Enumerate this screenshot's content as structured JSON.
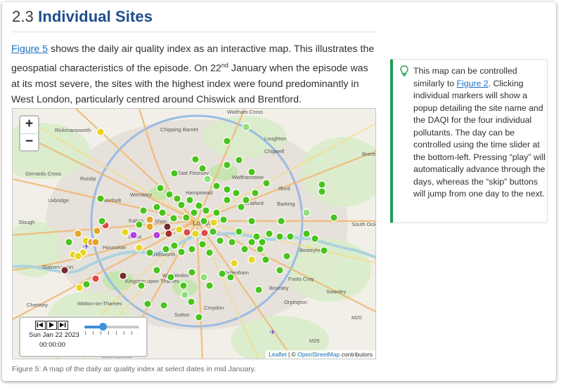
{
  "section": {
    "number": "2.3",
    "title": "Individual Sites"
  },
  "intro": {
    "figure_link": "Figure 5",
    "text_1": " shows the daily air quality index as an interactive map. This illustrates the geospatial characteristics of the episode. On 22",
    "sup": "nd",
    "text_2": " January when the episode was at its most severe, the sites with the highest index were found predominantly in West London, particularly centred around Chiswick and Brentford."
  },
  "map": {
    "zoom_in": "+",
    "zoom_out": "−",
    "place_labels": [
      "Waltham Cross",
      "Chipping Barnet",
      "Loughton",
      "Rickmansworth",
      "Chigwell",
      "Brentwo",
      "Gerrards Cross",
      "Ruislip",
      "East Finchley",
      "Walthamstow",
      "Hampstead",
      "Wembley",
      "Ilford",
      "Uxbridge",
      "Northolt",
      "Stratford",
      "Barking",
      "Slough",
      "Ealing",
      "Shep",
      "London",
      "South Ockend",
      "Brent",
      "Hounslow",
      "Bexleyheath",
      "Staines-upon",
      "Wandsworth",
      "Sydenham",
      "Kingston upon Thames",
      "Wimbledon",
      "Foots Cray",
      "Bromley",
      "Chertsey",
      "Walton-on-Thames",
      "Swanley",
      "Orpington",
      "Croydon",
      "Sutton",
      "Leatherhead",
      "M20",
      "M25"
    ],
    "time_control": {
      "back_icon": "skip-back-icon",
      "play_icon": "play-icon",
      "forward_icon": "skip-forward-icon",
      "date": "Sun Jan 22 2023",
      "time": "00:00:00",
      "slider_position": 0.33
    },
    "attribution": {
      "leaflet": "Leaflet",
      "separator": " | © ",
      "osm": "OpenStreetMap",
      "suffix": " contributors"
    },
    "aqi_colors": {
      "low": "#49c41c",
      "low_light": "#8fe07a",
      "moderate_yellow": "#e8d51e",
      "moderate_orange": "#e5a427",
      "high_red": "#e04747",
      "high_darkred": "#a52a2a",
      "very_high_maroon": "#7a2a2a",
      "very_high_purple": "#b43fe0"
    }
  },
  "caption": "Figure 5: A map of the daily air quality index at select dates in mid January.",
  "callout": {
    "icon": "lightbulb-icon",
    "text_1": "This map can be controlled similarly to ",
    "link": "Figure 2",
    "text_2": ". Clicking individual markers will show a popup detailing the site name and the DAQI for the four individual pollutants. The day can be controlled using the time slider at the bottom-left. Pressing “play” will automatically advance through the days, whereas the “skip” buttons will jump from one day to the next."
  },
  "colors": {
    "heading": "#1f4e8c",
    "link": "#1a6fc2",
    "callout_accent": "#1e9a55"
  }
}
